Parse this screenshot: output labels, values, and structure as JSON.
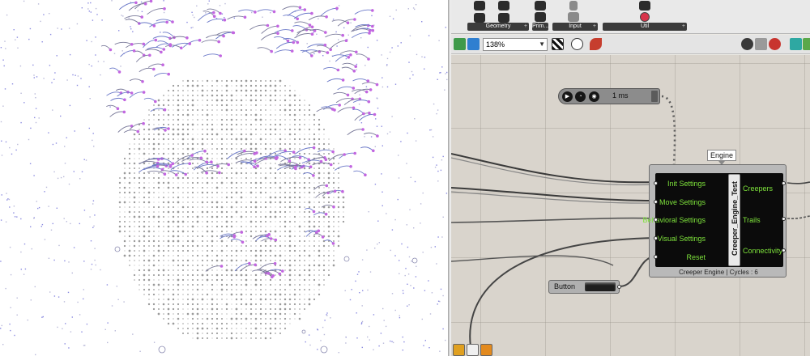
{
  "ribbon": {
    "groups": [
      {
        "label": "Geometry"
      },
      {
        "label": "Prim..."
      },
      {
        "label": "Input"
      },
      {
        "label": "Util"
      }
    ],
    "expand_glyph": "+"
  },
  "toolbar": {
    "zoom_value": "138%"
  },
  "canvas": {
    "timer": {
      "interval_label": "1 ms"
    },
    "tooltip": {
      "text": "Engine"
    },
    "component": {
      "title": "Creeper_Engine_Test",
      "inputs": [
        "Init Settings",
        "Move Settings",
        "Behavioral Settings",
        "Visual Settings",
        "Reset"
      ],
      "outputs": [
        "Creepers",
        "Trails",
        "Connectivity"
      ],
      "caption": "Creeper Engine | Cycles : 6"
    },
    "button_component": {
      "label": "Button"
    }
  },
  "colors": {
    "port_label_green": "#7ee33b",
    "canvas_bg": "#d9d4cc",
    "trail_magenta": "#c266e0",
    "trail_blue": "#6a78c8"
  }
}
